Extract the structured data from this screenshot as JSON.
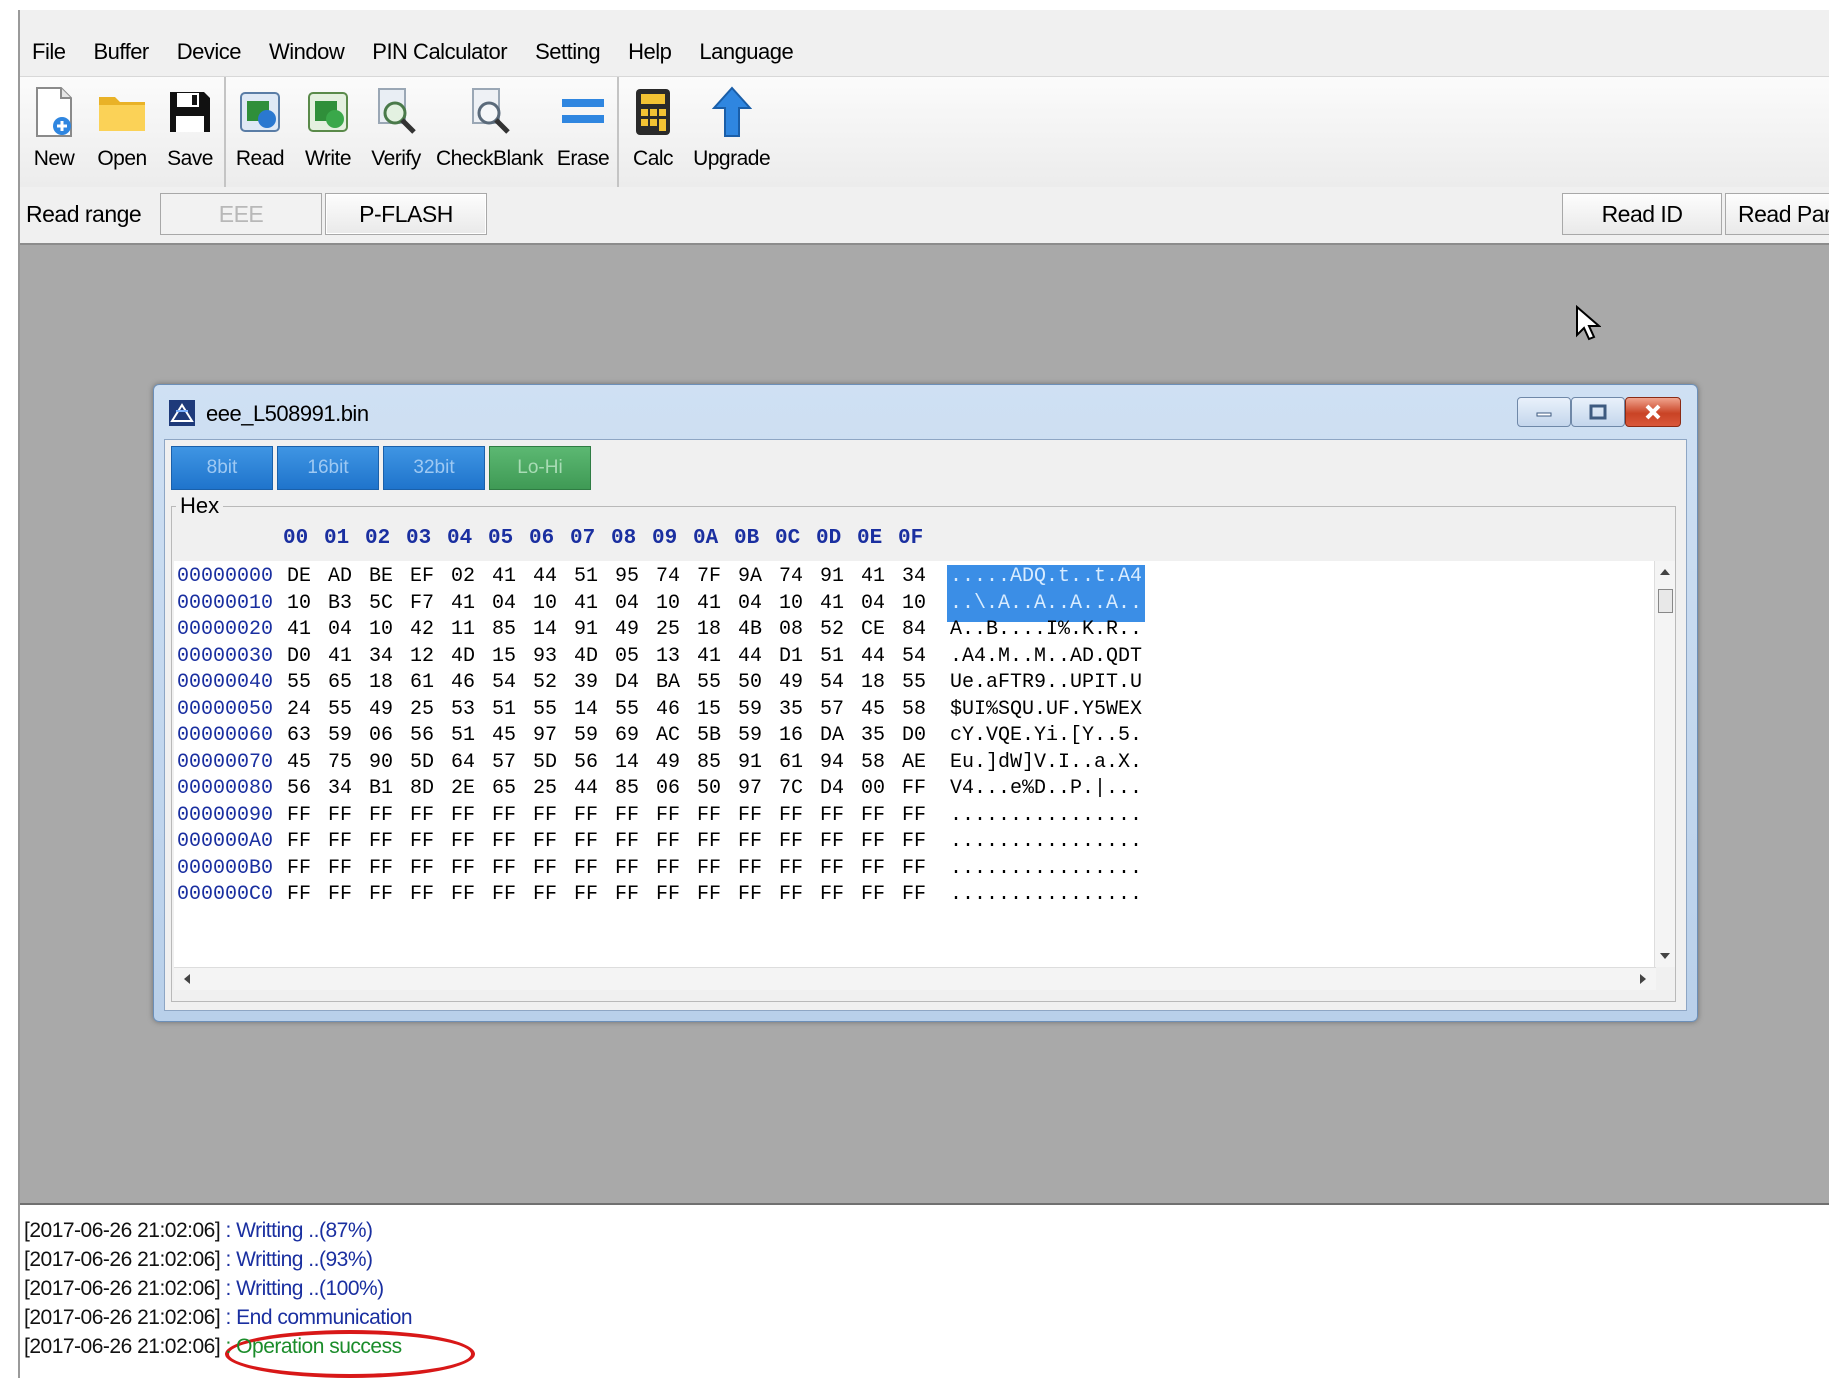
{
  "menu": [
    "File",
    "Buffer",
    "Device",
    "Window",
    "PIN Calculator",
    "Setting",
    "Help",
    "Language"
  ],
  "toolbar": {
    "new": "New",
    "open": "Open",
    "save": "Save",
    "read": "Read",
    "write": "Write",
    "verify": "Verify",
    "checkblank": "CheckBlank",
    "erase": "Erase",
    "calc": "Calc",
    "upgrade": "Upgrade"
  },
  "rangebar": {
    "label": "Read range",
    "eee": "EEE",
    "pflash": "P-FLASH",
    "read_id": "Read ID",
    "read_part": "Read Part"
  },
  "child_window": {
    "title": "eee_L508991.bin",
    "modes": [
      "8bit",
      "16bit",
      "32bit",
      "Lo-Hi"
    ],
    "group_caption": "Hex",
    "columns": [
      "00",
      "01",
      "02",
      "03",
      "04",
      "05",
      "06",
      "07",
      "08",
      "09",
      "0A",
      "0B",
      "0C",
      "0D",
      "0E",
      "0F"
    ],
    "rows": [
      {
        "addr": "00000000",
        "bytes": [
          "DE",
          "AD",
          "BE",
          "EF",
          "02",
          "41",
          "44",
          "51",
          "95",
          "74",
          "7F",
          "9A",
          "74",
          "91",
          "41",
          "34"
        ],
        "ascii": ".....ADQ.t..t.A4",
        "selected": true
      },
      {
        "addr": "00000010",
        "bytes": [
          "10",
          "B3",
          "5C",
          "F7",
          "41",
          "04",
          "10",
          "41",
          "04",
          "10",
          "41",
          "04",
          "10",
          "41",
          "04",
          "10"
        ],
        "ascii": "..\\.A..A..A..A..",
        "selected": true
      },
      {
        "addr": "00000020",
        "bytes": [
          "41",
          "04",
          "10",
          "42",
          "11",
          "85",
          "14",
          "91",
          "49",
          "25",
          "18",
          "4B",
          "08",
          "52",
          "CE",
          "84"
        ],
        "ascii": "A..B....I%.K.R..",
        "selected": false
      },
      {
        "addr": "00000030",
        "bytes": [
          "D0",
          "41",
          "34",
          "12",
          "4D",
          "15",
          "93",
          "4D",
          "05",
          "13",
          "41",
          "44",
          "D1",
          "51",
          "44",
          "54"
        ],
        "ascii": ".A4.M..M..AD.QDT",
        "selected": false
      },
      {
        "addr": "00000040",
        "bytes": [
          "55",
          "65",
          "18",
          "61",
          "46",
          "54",
          "52",
          "39",
          "D4",
          "BA",
          "55",
          "50",
          "49",
          "54",
          "18",
          "55"
        ],
        "ascii": "Ue.aFTR9..UPIT.U",
        "selected": false
      },
      {
        "addr": "00000050",
        "bytes": [
          "24",
          "55",
          "49",
          "25",
          "53",
          "51",
          "55",
          "14",
          "55",
          "46",
          "15",
          "59",
          "35",
          "57",
          "45",
          "58"
        ],
        "ascii": "$UI%SQU.UF.Y5WEX",
        "selected": false
      },
      {
        "addr": "00000060",
        "bytes": [
          "63",
          "59",
          "06",
          "56",
          "51",
          "45",
          "97",
          "59",
          "69",
          "AC",
          "5B",
          "59",
          "16",
          "DA",
          "35",
          "D0"
        ],
        "ascii": "cY.VQE.Yi.[Y..5.",
        "selected": false
      },
      {
        "addr": "00000070",
        "bytes": [
          "45",
          "75",
          "90",
          "5D",
          "64",
          "57",
          "5D",
          "56",
          "14",
          "49",
          "85",
          "91",
          "61",
          "94",
          "58",
          "AE"
        ],
        "ascii": "Eu.]dW]V.I..a.X.",
        "selected": false
      },
      {
        "addr": "00000080",
        "bytes": [
          "56",
          "34",
          "B1",
          "8D",
          "2E",
          "65",
          "25",
          "44",
          "85",
          "06",
          "50",
          "97",
          "7C",
          "D4",
          "00",
          "FF"
        ],
        "ascii": "V4...e%D..P.|...",
        "selected": false
      },
      {
        "addr": "00000090",
        "bytes": [
          "FF",
          "FF",
          "FF",
          "FF",
          "FF",
          "FF",
          "FF",
          "FF",
          "FF",
          "FF",
          "FF",
          "FF",
          "FF",
          "FF",
          "FF",
          "FF"
        ],
        "ascii": "................",
        "selected": false
      },
      {
        "addr": "000000A0",
        "bytes": [
          "FF",
          "FF",
          "FF",
          "FF",
          "FF",
          "FF",
          "FF",
          "FF",
          "FF",
          "FF",
          "FF",
          "FF",
          "FF",
          "FF",
          "FF",
          "FF"
        ],
        "ascii": "................",
        "selected": false
      },
      {
        "addr": "000000B0",
        "bytes": [
          "FF",
          "FF",
          "FF",
          "FF",
          "FF",
          "FF",
          "FF",
          "FF",
          "FF",
          "FF",
          "FF",
          "FF",
          "FF",
          "FF",
          "FF",
          "FF"
        ],
        "ascii": "................",
        "selected": false
      },
      {
        "addr": "000000C0",
        "bytes": [
          "FF",
          "FF",
          "FF",
          "FF",
          "FF",
          "FF",
          "FF",
          "FF",
          "FF",
          "FF",
          "FF",
          "FF",
          "FF",
          "FF",
          "FF",
          "FF"
        ],
        "ascii": "................",
        "selected": false
      }
    ]
  },
  "log": [
    {
      "time": "[2017-06-26 21:02:06]",
      "msg": " : Writting ..(87%)",
      "ok": false
    },
    {
      "time": "[2017-06-26 21:02:06]",
      "msg": " : Writting ..(93%)",
      "ok": false
    },
    {
      "time": "[2017-06-26 21:02:06]",
      "msg": " : Writting ..(100%)",
      "ok": false
    },
    {
      "time": "[2017-06-26 21:02:06]",
      "msg": " : End communication",
      "ok": false
    },
    {
      "time": "[2017-06-26 21:02:06]",
      "msg": " : Operation success",
      "ok": true
    }
  ],
  "colors": {
    "accent": "#1f74cc",
    "hex_text": "#1a2fa0",
    "success": "#1a8c2a",
    "highlight": "#d81818"
  }
}
